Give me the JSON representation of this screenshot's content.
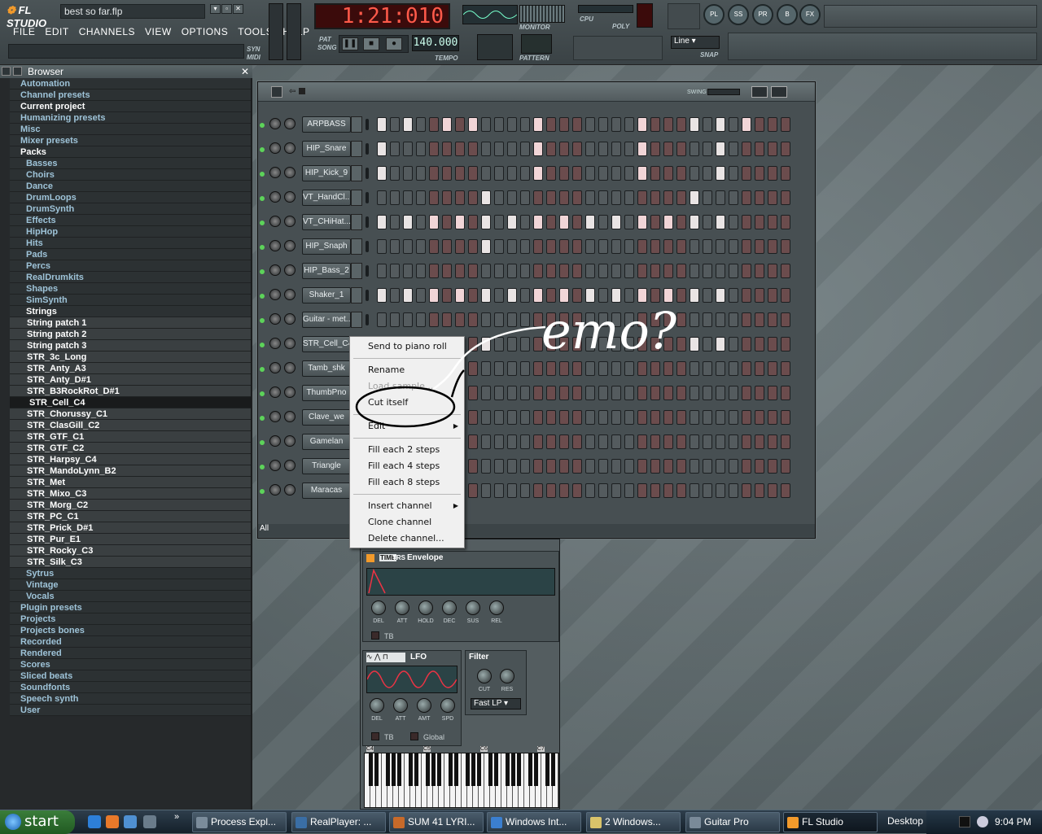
{
  "app": {
    "title": "FL STUDIO",
    "song": "best so far.flp"
  },
  "menu": [
    "FILE",
    "EDIT",
    "CHANNELS",
    "VIEW",
    "OPTIONS",
    "TOOLS",
    "HELP"
  ],
  "time_display": "1:21:010",
  "tempo": "140.000",
  "labels": {
    "monitor": "MONITOR",
    "tempo": "TEMPO",
    "pattern": "PATTERN",
    "cpu": "CPU",
    "poly": "POLY",
    "snap": "SNAP",
    "swing": "SWING",
    "pat": "PAT",
    "song": "SONG",
    "syn": "SYN",
    "midi": "MIDI"
  },
  "snap": "Line",
  "plugin_buttons": [
    "PL",
    "SS",
    "PR",
    "B",
    "FX"
  ],
  "browser": {
    "title": "Browser",
    "items": [
      {
        "t": "Automation",
        "k": "folder"
      },
      {
        "t": "Channel presets",
        "k": "folder"
      },
      {
        "t": "Current project",
        "k": "open"
      },
      {
        "t": "Humanizing presets",
        "k": "folder"
      },
      {
        "t": "Misc",
        "k": "folder"
      },
      {
        "t": "Mixer presets",
        "k": "folder"
      },
      {
        "t": "Packs",
        "k": "open"
      },
      {
        "t": "Basses",
        "k": "pack"
      },
      {
        "t": "Choirs",
        "k": "pack"
      },
      {
        "t": "Dance",
        "k": "pack"
      },
      {
        "t": "DrumLoops",
        "k": "pack"
      },
      {
        "t": "DrumSynth",
        "k": "pack"
      },
      {
        "t": "Effects",
        "k": "pack"
      },
      {
        "t": "HipHop",
        "k": "pack"
      },
      {
        "t": "Hits",
        "k": "pack"
      },
      {
        "t": "Pads",
        "k": "pack"
      },
      {
        "t": "Percs",
        "k": "pack"
      },
      {
        "t": "RealDrumkits",
        "k": "pack"
      },
      {
        "t": "Shapes",
        "k": "pack"
      },
      {
        "t": "SimSynth",
        "k": "pack"
      },
      {
        "t": "Strings",
        "k": "packopen"
      },
      {
        "t": "String patch 1",
        "k": "file"
      },
      {
        "t": "String patch 2",
        "k": "file"
      },
      {
        "t": "String patch 3",
        "k": "file"
      },
      {
        "t": "STR_3c_Long",
        "k": "file"
      },
      {
        "t": "STR_Anty_A3",
        "k": "file"
      },
      {
        "t": "STR_Anty_D#1",
        "k": "file"
      },
      {
        "t": "STR_B3RockRot_D#1",
        "k": "file"
      },
      {
        "t": "STR_Cell_C4",
        "k": "sel"
      },
      {
        "t": "STR_Chorussy_C1",
        "k": "file"
      },
      {
        "t": "STR_ClasGill_C2",
        "k": "file"
      },
      {
        "t": "STR_GTF_C1",
        "k": "file"
      },
      {
        "t": "STR_GTF_C2",
        "k": "file"
      },
      {
        "t": "STR_Harpsy_C4",
        "k": "file"
      },
      {
        "t": "STR_MandoLynn_B2",
        "k": "file"
      },
      {
        "t": "STR_Met",
        "k": "file"
      },
      {
        "t": "STR_Mixo_C3",
        "k": "file"
      },
      {
        "t": "STR_Morg_C2",
        "k": "file"
      },
      {
        "t": "STR_PC_C1",
        "k": "file"
      },
      {
        "t": "STR_Prick_D#1",
        "k": "file"
      },
      {
        "t": "STR_Pur_E1",
        "k": "file"
      },
      {
        "t": "STR_Rocky_C3",
        "k": "file"
      },
      {
        "t": "STR_Silk_C3",
        "k": "file"
      },
      {
        "t": "Sytrus",
        "k": "pack"
      },
      {
        "t": "Vintage",
        "k": "pack"
      },
      {
        "t": "Vocals",
        "k": "pack"
      },
      {
        "t": "Plugin presets",
        "k": "folder"
      },
      {
        "t": "Projects",
        "k": "folder"
      },
      {
        "t": "Projects bones",
        "k": "folder"
      },
      {
        "t": "Recorded",
        "k": "folder"
      },
      {
        "t": "Rendered",
        "k": "folder"
      },
      {
        "t": "Scores",
        "k": "folder"
      },
      {
        "t": "Sliced beats",
        "k": "folder"
      },
      {
        "t": "Soundfonts",
        "k": "folder"
      },
      {
        "t": "Speech synth",
        "k": "folder"
      },
      {
        "t": "User",
        "k": "folder"
      }
    ]
  },
  "channels": [
    {
      "name": "ARPBASS",
      "on": [
        0,
        2,
        5,
        7,
        12,
        20,
        24,
        26,
        28
      ]
    },
    {
      "name": "HIP_Snare",
      "on": [
        0,
        12,
        20,
        26
      ]
    },
    {
      "name": "HIP_Kick_9",
      "on": [
        0,
        12,
        20,
        26
      ]
    },
    {
      "name": "VT_HandCl...",
      "on": [
        8,
        24
      ]
    },
    {
      "name": "VT_CHiHat...",
      "on": [
        0,
        2,
        4,
        6,
        8,
        10,
        12,
        14,
        16,
        18,
        20,
        22,
        24,
        26
      ]
    },
    {
      "name": "HIP_Snaph",
      "on": [
        8
      ]
    },
    {
      "name": "HIP_Bass_2",
      "on": []
    },
    {
      "name": "Shaker_1",
      "on": [
        0,
        2,
        4,
        6,
        8,
        10,
        12,
        14,
        16,
        18,
        20,
        22,
        24,
        26
      ]
    },
    {
      "name": "Guitar - met...",
      "on": []
    },
    {
      "name": "STR_Cell_C4",
      "on": [
        8,
        24,
        26
      ]
    },
    {
      "name": "Tamb_shk",
      "on": []
    },
    {
      "name": "ThumbPno",
      "on": []
    },
    {
      "name": "Clave_we",
      "on": []
    },
    {
      "name": "Gamelan",
      "on": []
    },
    {
      "name": "Triangle",
      "on": []
    },
    {
      "name": "Maracas",
      "on": []
    }
  ],
  "filter_all": "All",
  "context_menu": [
    {
      "t": "Send to piano roll"
    },
    {
      "sep": true
    },
    {
      "t": "Rename"
    },
    {
      "t": "Load sample...",
      "dis": true
    },
    {
      "t": "Cut itself"
    },
    {
      "sep": true
    },
    {
      "t": "Edit",
      "sub": true
    },
    {
      "sep": true
    },
    {
      "t": "Fill each 2 steps"
    },
    {
      "t": "Fill each 4 steps"
    },
    {
      "t": "Fill each 8 steps"
    },
    {
      "sep": true
    },
    {
      "t": "Insert channel",
      "sub": true
    },
    {
      "t": "Clone channel"
    },
    {
      "t": "Delete channel..."
    }
  ],
  "annotation": "emo?",
  "channel_settings": {
    "tabs": [
      "TIME",
      "TRS"
    ],
    "envelope": "Envelope",
    "env_knobs": [
      "DEL",
      "ATT",
      "HOLD",
      "DEC",
      "SUS",
      "REL"
    ],
    "tb": "TB",
    "lfo": "LFO",
    "lfo_knobs": [
      "DEL",
      "ATT",
      "AMT",
      "SPD"
    ],
    "global": "Global",
    "filter": "Filter",
    "filter_knobs": [
      "CUT",
      "RES"
    ],
    "filter_type": "Fast LP",
    "key_labels": [
      "C4",
      "C5",
      "C6",
      "C7"
    ]
  },
  "taskbar": {
    "start": "start",
    "tasks": [
      "Process Expl...",
      "RealPlayer: ...",
      "SUM 41 LYRI...",
      "Windows Int...",
      "2 Windows...",
      "Guitar Pro",
      "FL Studio"
    ],
    "desktop": "Desktop",
    "clock": "9:04 PM"
  },
  "colors": {
    "led_green": "#5dd35a",
    "lcd_red": "#ff5a4a",
    "step_on": "#e9e4e4",
    "accent_orange": "#f29a2b"
  }
}
